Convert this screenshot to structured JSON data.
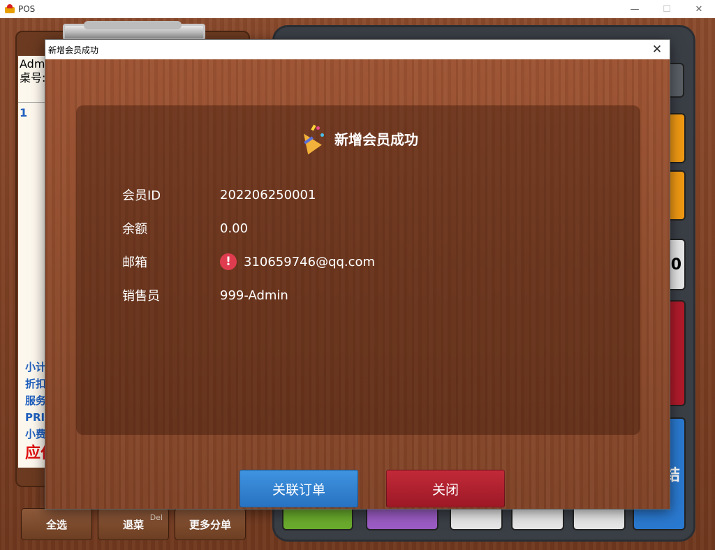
{
  "window": {
    "title": "POS",
    "minimize": "—",
    "maximize": "☐",
    "close": "✕"
  },
  "order": {
    "header_line1": "Adm",
    "header_line2": "桌号:",
    "first_item": "1",
    "summary": [
      "小计",
      "折扣",
      "服务",
      "PRI",
      "小费"
    ],
    "due_label": "应付"
  },
  "calculator": {
    "key_zero": "0",
    "key_checkout": "结"
  },
  "bottom_buttons": {
    "select_all": "全选",
    "return_dish": "退菜",
    "return_dish_shortcut": "Del",
    "more_split": "更多分单"
  },
  "dialog": {
    "title": "新增会员成功",
    "close_glyph": "✕",
    "header": "新增会员成功",
    "fields": [
      {
        "label": "会员ID",
        "value": "202206250001"
      },
      {
        "label": "余额",
        "value": "0.00"
      },
      {
        "label": "邮箱",
        "value": "310659746@qq.com",
        "warning": "!"
      },
      {
        "label": "销售员",
        "value": "999-Admin"
      }
    ],
    "link_order_button": "关联订单",
    "close_button": "关闭"
  },
  "colors": {
    "accent_blue": "#2f80d0",
    "close_red": "#b01f2e",
    "warning": "#e03c50",
    "summary_blue": "#1f5fbf",
    "due_red": "#e01010"
  }
}
